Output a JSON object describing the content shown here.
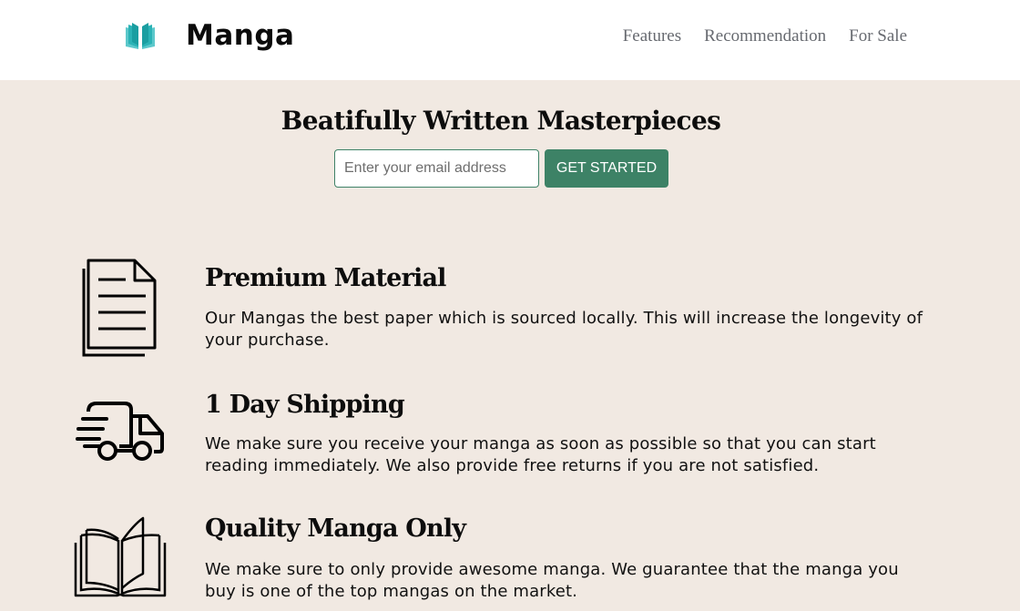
{
  "header": {
    "brand": "Manga",
    "logo_icon": "open-book-icon",
    "logo_color": "#2bb3b6",
    "nav": [
      "Features",
      "Recommendation",
      "For Sale"
    ]
  },
  "hero": {
    "title": "Beatifully Written Masterpieces",
    "email_placeholder": "Enter your email address",
    "button_label": "GET STARTED",
    "button_color": "#3d8266"
  },
  "features": [
    {
      "icon": "document-icon",
      "title": "Premium Material",
      "description": "Our Mangas the best paper which is sourced locally. This will increase the longevity of your purchase."
    },
    {
      "icon": "delivery-truck-icon",
      "title": "1 Day Shipping",
      "description": "We make sure you receive your manga as soon as possible so that you can start reading immediately. We also provide free returns if you are not satisfied."
    },
    {
      "icon": "open-book-outline-icon",
      "title": "Quality Manga Only",
      "description": "We make sure to only provide awesome manga. We guarantee that the manga you buy is one of the top mangas on the market."
    }
  ],
  "colors": {
    "background": "#f1e9e2",
    "header_background": "#ffffff",
    "nav_text": "#676a70"
  }
}
